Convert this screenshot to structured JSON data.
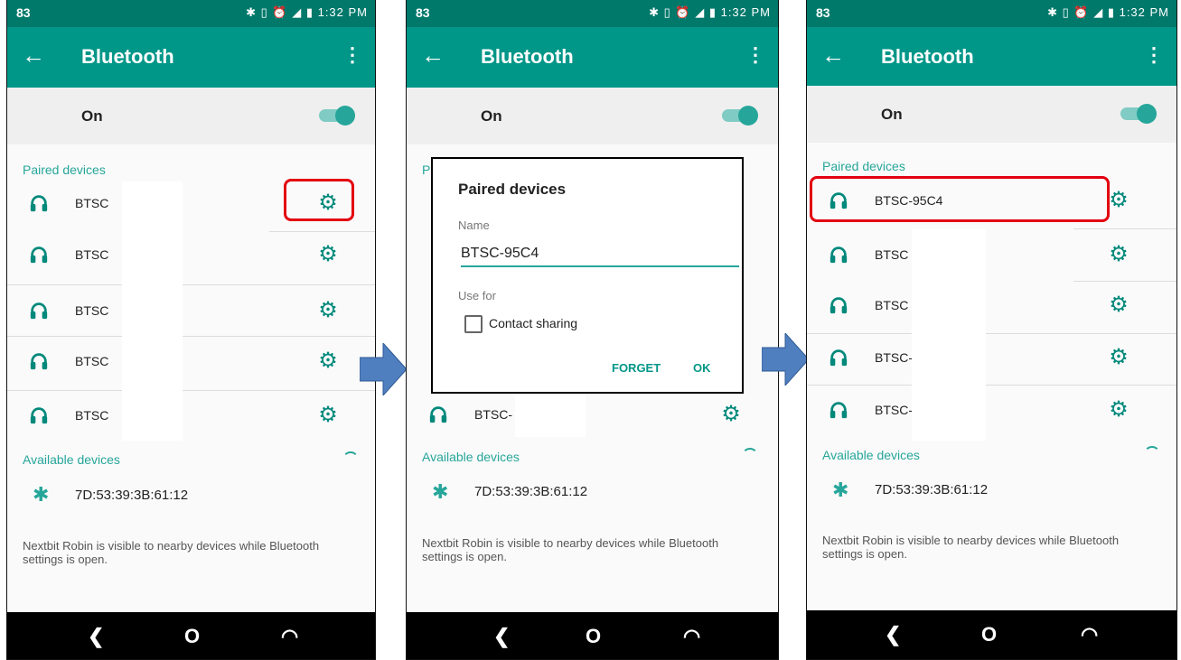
{
  "status_bar": {
    "battery": "83",
    "time_icons": "✱ ▯ ⏰ ◢ ▮ 1:32 PM"
  },
  "app_bar": {
    "back_icon": "arrow-left-icon",
    "title": "Bluetooth",
    "more_icon": "more-vert-icon"
  },
  "toggle": {
    "label": "On",
    "state": "on"
  },
  "paired_section": {
    "title": "Paired devices"
  },
  "paired_devices": [
    "BTSC",
    "BTSC",
    "BTSC",
    "BTSC",
    "BTSC"
  ],
  "screen2_paired_last": "BTSC-",
  "screen3_paired_devices": [
    "BTSC-95C4",
    "BTSC",
    "BTSC",
    "BTSC-",
    "BTSC-"
  ],
  "available_section": {
    "title": "Available devices"
  },
  "available_device": "7D:53:39:3B:61:12",
  "footer": "Nextbit Robin is visible to nearby devices while Bluetooth settings is open.",
  "dialog": {
    "title": "Paired devices",
    "name_label": "Name",
    "name_value": "BTSC-95C4",
    "use_for_label": "Use for",
    "contact_sharing": "Contact sharing",
    "forget_button": "FORGET",
    "ok_button": "OK"
  },
  "nav": {
    "back": "❮",
    "home": "O",
    "recents": "◠"
  },
  "colors": {
    "status": "#00796b",
    "appbar": "#009688",
    "accent": "#26a69a",
    "highlight": "#e3000f",
    "arrow": "#4f7fbf"
  }
}
